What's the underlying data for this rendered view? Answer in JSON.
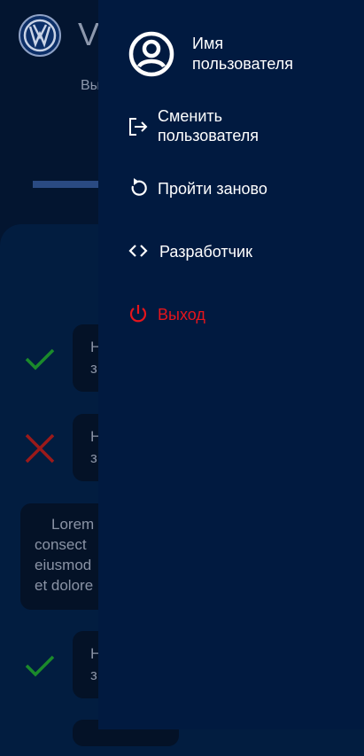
{
  "background_app": {
    "title": "V",
    "subtitle": "Вы",
    "questions": [
      {
        "status": "correct",
        "line1": "Н",
        "line2": "з"
      },
      {
        "status": "wrong",
        "line1": "Н",
        "line2": "з"
      },
      {
        "status": "correct",
        "line1": "Н",
        "line2": "з"
      }
    ],
    "lorem_card": {
      "line1": "Lorem",
      "line2": "consect",
      "line3": "eiusmod",
      "line4": "et dolore"
    }
  },
  "drawer": {
    "user_name": "Имя\nпользователя",
    "items": [
      {
        "icon": "switch-user-icon",
        "label": "Сменить\nпользователя"
      },
      {
        "icon": "restart-icon",
        "label": "Пройти заново"
      },
      {
        "icon": "code-icon",
        "label": "Разработчик"
      },
      {
        "icon": "power-icon",
        "label": "Выход"
      }
    ]
  },
  "colors": {
    "drawer_bg": "#011a40",
    "danger": "#e5151c",
    "correct": "#1b8a2b",
    "wrong": "#9b1a1a"
  }
}
